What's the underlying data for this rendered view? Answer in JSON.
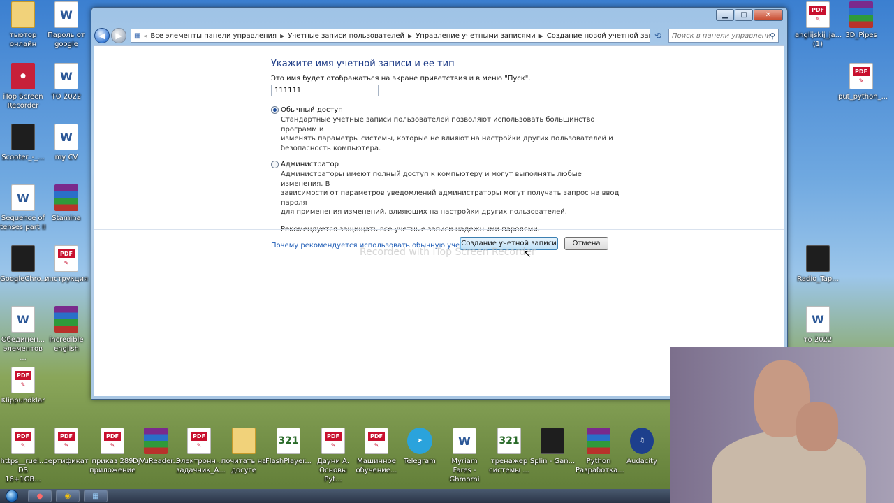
{
  "desktop_icons": [
    {
      "label": "тьютор онлайн",
      "kind": "folder",
      "icon": "folder-icon"
    },
    {
      "label": "Пароль от google",
      "kind": "doc",
      "icon": "word-doc-icon"
    },
    {
      "label": "iTop Screen Recorder",
      "kind": "red",
      "icon": "screen-recorder-icon"
    },
    {
      "label": "ТО 2022",
      "kind": "doc",
      "icon": "word-doc-icon"
    },
    {
      "label": "Scooter_-_...",
      "kind": "app",
      "icon": "media-file-icon"
    },
    {
      "label": "my CV",
      "kind": "doc",
      "icon": "word-doc-icon"
    },
    {
      "label": "Sequence of tenses part II",
      "kind": "doc",
      "icon": "document-icon"
    },
    {
      "label": "Stamina",
      "kind": "rar",
      "icon": "archive-icon"
    },
    {
      "label": "GoogleChro...",
      "kind": "app",
      "icon": "installer-icon"
    },
    {
      "label": "инструкция",
      "kind": "pdf",
      "icon": "pdf-icon"
    },
    {
      "label": "Обединен... элементов ...",
      "kind": "doc",
      "icon": "document-icon"
    },
    {
      "label": "incredible english",
      "kind": "rar",
      "icon": "archive-icon"
    },
    {
      "label": "Klippundklar",
      "kind": "pdf",
      "icon": "pdf-icon"
    },
    {
      "label": "anglijskij_ja... (1)",
      "kind": "pdf",
      "icon": "pdf-icon"
    },
    {
      "label": "3D_Pipes",
      "kind": "rar",
      "icon": "archive-icon"
    },
    {
      "label": "put_python_...",
      "kind": "pdf",
      "icon": "pdf-icon"
    },
    {
      "label": "Radio_Tap...",
      "kind": "app",
      "icon": "media-file-icon"
    },
    {
      "label": "то 2022",
      "kind": "doc",
      "icon": "document-icon"
    }
  ],
  "bottom_icons": [
    {
      "label": "https__ruei... DS 16+1GB...",
      "kind": "pdf",
      "icon": "pdf-icon"
    },
    {
      "label": "сертификат",
      "kind": "pdf",
      "icon": "pdf-icon"
    },
    {
      "label": "приказ 289 приложение",
      "kind": "pdf",
      "icon": "pdf-icon"
    },
    {
      "label": "DjVuReader...",
      "kind": "rar",
      "icon": "archive-icon"
    },
    {
      "label": "Электронн... задачник_А...",
      "kind": "pdf",
      "icon": "pdf-icon"
    },
    {
      "label": "почитать на досуге",
      "kind": "folder",
      "icon": "folder-icon"
    },
    {
      "label": "FlashPlayer...",
      "kind": "num",
      "icon": "media-player-icon"
    },
    {
      "label": "Дауни А. Основы Pyt...",
      "kind": "pdf",
      "icon": "pdf-icon"
    },
    {
      "label": "Машинное обучение...",
      "kind": "pdf",
      "icon": "pdf-icon"
    },
    {
      "label": "Telegram",
      "kind": "tg",
      "icon": "telegram-icon"
    },
    {
      "label": "Myriam Fares - Ghmorni",
      "kind": "doc",
      "icon": "mp3-icon"
    },
    {
      "label": "тренажер системы ...",
      "kind": "num",
      "icon": "media-player-icon"
    },
    {
      "label": "Splin - Gan...",
      "kind": "app",
      "icon": "image-icon"
    },
    {
      "label": "Python Разработка...",
      "kind": "rar",
      "icon": "archive-icon"
    },
    {
      "label": "Audacity",
      "kind": "audio",
      "icon": "audacity-icon"
    }
  ],
  "window": {
    "address": {
      "crumbs": [
        "Все элементы панели управления",
        "Учетные записи пользователей",
        "Управление учетными записями",
        "Создание новой учетной записи"
      ]
    },
    "search_placeholder": "Поиск в панели управления",
    "form": {
      "heading": "Укажите имя учетной записи и ее тип",
      "description": "Это имя будет отображаться на экране приветствия и в меню \"Пуск\".",
      "name_value": "111111",
      "standard": {
        "label": "Обычный доступ",
        "selected": true,
        "lines": [
          "Стандартные учетные записи пользователей позволяют использовать большинство программ и",
          "изменять параметры системы, которые не влияют на настройки других пользователей и",
          "безопасность компьютера."
        ]
      },
      "admin": {
        "label": "Администратор",
        "selected": false,
        "lines": [
          "Администраторы имеют полный доступ к компьютеру и могут выполнять любые изменения. В",
          "зависимости от параметров уведомлений администраторы могут получать запрос на ввод пароля",
          "для применения изменений, влияющих на настройки других пользователей."
        ]
      },
      "note": "Рекомендуется защищать все учетные записи надежными паролями.",
      "help_link": "Почему рекомендуется использовать обычную учетную запись?"
    },
    "buttons": {
      "create": "Создание учетной записи",
      "cancel": "Отмена"
    }
  },
  "watermark": "Recorded with iTop Screen Recorder"
}
